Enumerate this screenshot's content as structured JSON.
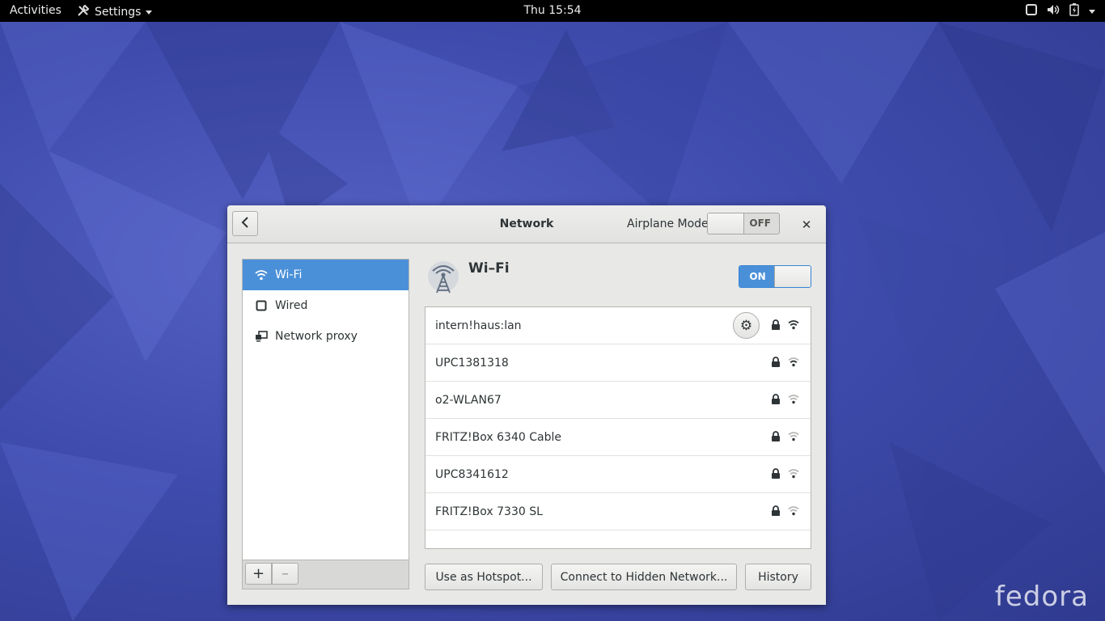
{
  "topbar": {
    "activities": "Activities",
    "app_menu": "Settings",
    "clock": "Thu 15:54",
    "status_icons": [
      "screen-icon",
      "volume-icon",
      "battery-icon",
      "system-menu-caret-icon"
    ]
  },
  "desktop": {
    "logo_text": "fedora",
    "wallpaper_color": "#3d4ba8"
  },
  "window": {
    "title": "Network",
    "airplane_mode": {
      "label": "Airplane Mode",
      "state": "OFF"
    },
    "sidebar": {
      "items": [
        {
          "label": "Wi-Fi",
          "icon": "wifi-icon",
          "selected": true
        },
        {
          "label": "Wired",
          "icon": "wired-icon",
          "selected": false
        },
        {
          "label": "Network proxy",
          "icon": "proxy-icon",
          "selected": false
        }
      ],
      "add_label": "+",
      "remove_label": "–"
    },
    "wifi": {
      "title": "Wi–Fi",
      "switch_state": "ON",
      "networks": [
        {
          "name": "intern!haus:lan",
          "secured": true,
          "connected": true,
          "signal": "strong"
        },
        {
          "name": "UPC1381318",
          "secured": true,
          "connected": false,
          "signal": "good"
        },
        {
          "name": "o2-WLAN67",
          "secured": true,
          "connected": false,
          "signal": "weak"
        },
        {
          "name": "FRITZ!Box 6340 Cable",
          "secured": true,
          "connected": false,
          "signal": "weak"
        },
        {
          "name": "UPC8341612",
          "secured": true,
          "connected": false,
          "signal": "weak"
        },
        {
          "name": "FRITZ!Box 7330 SL",
          "secured": true,
          "connected": false,
          "signal": "weak"
        }
      ]
    },
    "buttons": {
      "hotspot": "Use as Hotspot...",
      "hidden": "Connect to Hidden Network...",
      "history": "History"
    },
    "accent_color": "#4a90d9"
  }
}
